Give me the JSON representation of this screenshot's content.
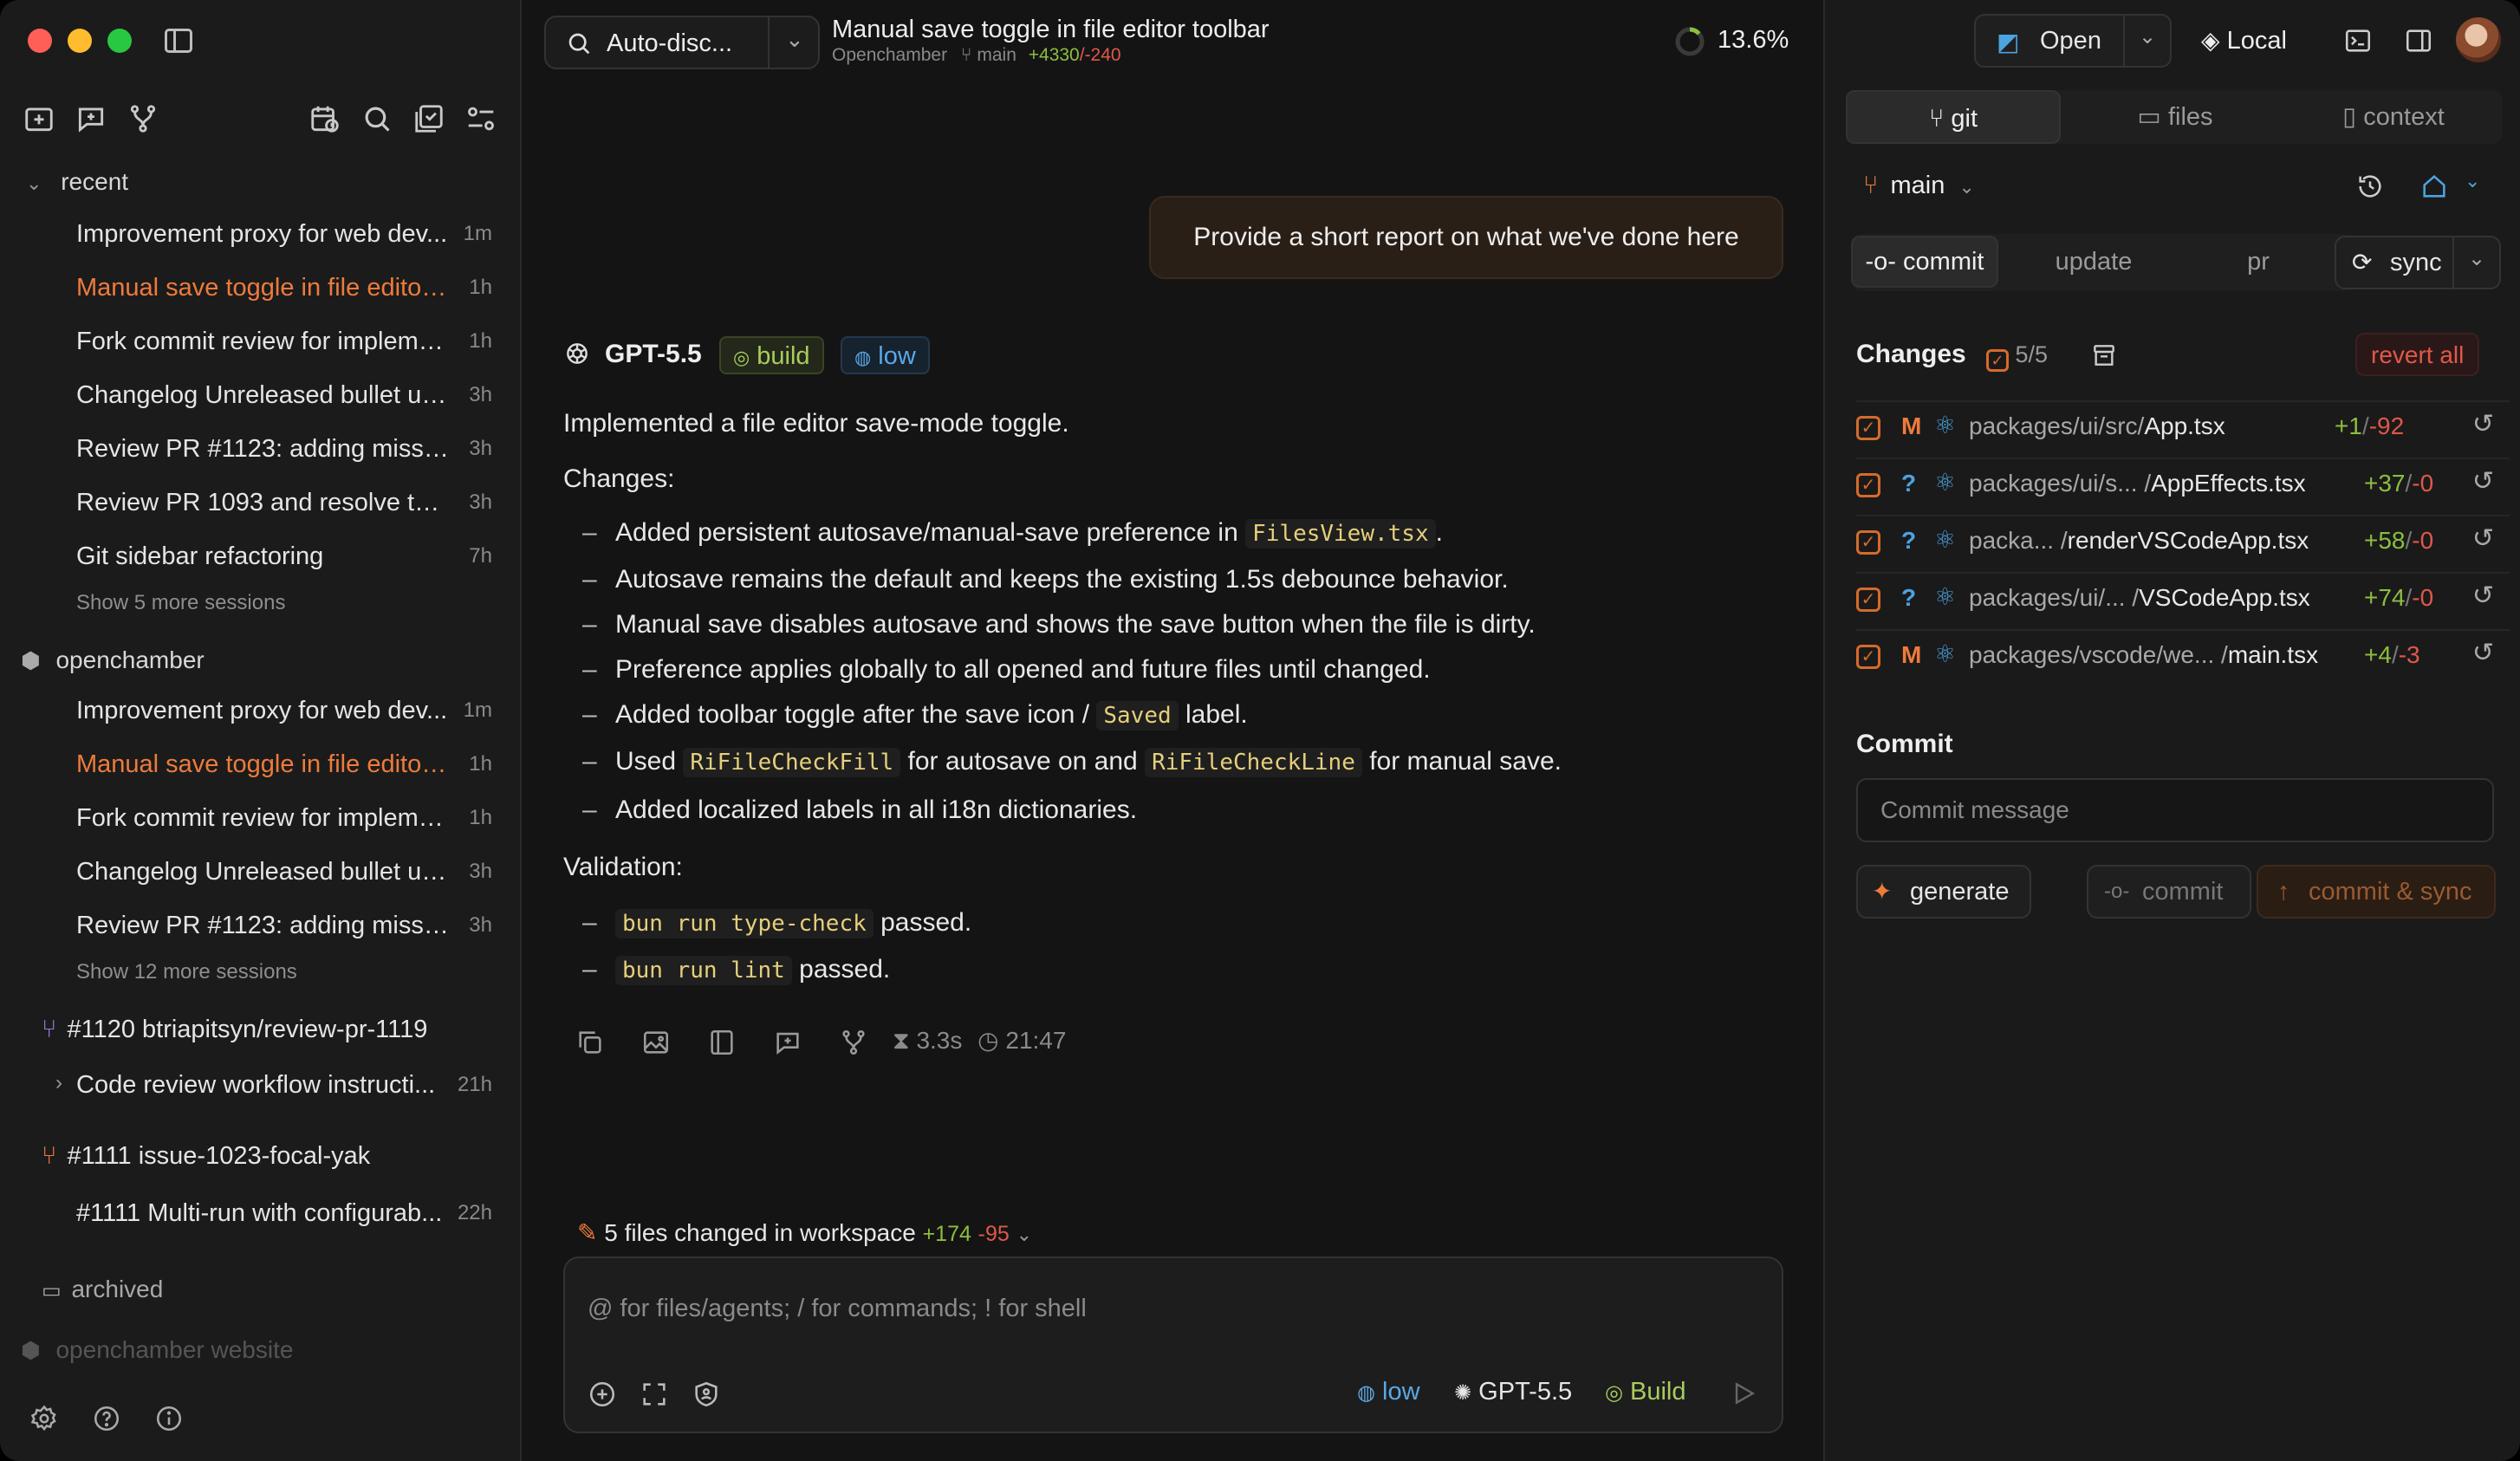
{
  "sidebar": {
    "recent_label": "recent",
    "recent": [
      {
        "title": "Improvement proxy for web dev...",
        "time": "1m"
      },
      {
        "title": "Manual save toggle in file editor...",
        "time": "1h"
      },
      {
        "title": "Fork commit review for impleme...",
        "time": "1h"
      },
      {
        "title": "Changelog Unreleased bullet up...",
        "time": "3h"
      },
      {
        "title": "Review PR #1123: adding missin...",
        "time": "3h"
      },
      {
        "title": "Review PR 1093 and resolve the...",
        "time": "3h"
      },
      {
        "title": "Git sidebar refactoring",
        "time": "7h"
      }
    ],
    "recent_more": "Show 5 more sessions",
    "project_label": "openchamber",
    "project": [
      {
        "title": "Improvement proxy for web dev...",
        "time": "1m"
      },
      {
        "title": "Manual save toggle in file editor...",
        "time": "1h"
      },
      {
        "title": "Fork commit review for impleme...",
        "time": "1h"
      },
      {
        "title": "Changelog Unreleased bullet up...",
        "time": "3h"
      },
      {
        "title": "Review PR #1123: adding missin...",
        "time": "3h"
      }
    ],
    "project_more": "Show 12 more sessions",
    "wt1_label": "#1120 btriapitsyn/review-pr-1119",
    "wt1_item": {
      "title": "Code review workflow instructi...",
      "time": "21h"
    },
    "wt2_label": "#1111 issue-1023-focal-yak",
    "wt2_item": {
      "title": "#1111 Multi-run with configurab...",
      "time": "22h"
    },
    "archived_label": "archived",
    "website_label": "openchamber website"
  },
  "header": {
    "agent_select": "Auto-disc...",
    "title": "Manual save toggle in file editor toolbar",
    "repo": "Openchamber",
    "branch": "main",
    "added": "+4330",
    "removed": "/-240",
    "progress": "13.6%"
  },
  "chat": {
    "user_message": "Provide a short report on what we've done here",
    "model": "GPT-5.5",
    "mode_tag": "build",
    "effort_tag": "low",
    "intro": "Implemented a file editor save-mode toggle.",
    "changes_heading": "Changes:",
    "b1_pre": "Added persistent autosave/manual-save preference in ",
    "b1_code": "FilesView.tsx",
    "b1_post": ".",
    "b2": "Autosave remains the default and keeps the existing 1.5s debounce behavior.",
    "b3": "Manual save disables autosave and shows the save button when the file is dirty.",
    "b4": "Preference applies globally to all opened and future files until changed.",
    "b5_pre": "Added toolbar toggle after the save icon / ",
    "b5_code": "Saved",
    "b5_post": " label.",
    "b6_pre": "Used ",
    "b6_code1": "RiFileCheckFill",
    "b6_mid": " for autosave on and ",
    "b6_code2": "RiFileCheckLine",
    "b6_post": " for manual save.",
    "b7": "Added localized labels in all i18n dictionaries.",
    "validation_heading": "Validation:",
    "v1_code": "bun run type-check",
    "v1_post": " passed.",
    "v2_code": "bun run lint",
    "v2_post": " passed.",
    "duration": "3.3s",
    "clock": "21:47",
    "files_changed": "5 files changed in workspace",
    "files_added": "+174",
    "files_removed": "-95"
  },
  "composer": {
    "placeholder": "@ for files/agents; / for commands; ! for shell",
    "effort": "low",
    "model": "GPT-5.5",
    "mode": "Build"
  },
  "topright": {
    "open_label": "Open",
    "local_label": "Local"
  },
  "git": {
    "tabs": [
      "git",
      "files",
      "context"
    ],
    "branch": "main",
    "subtabs": [
      "commit",
      "update",
      "pr"
    ],
    "sync_label": "sync",
    "changes_label": "Changes",
    "changes_count": "5/5",
    "revert_all": "revert all",
    "files": [
      {
        "status": "M",
        "dir": "packages/ui/src/",
        "name": "App.tsx",
        "add": "+1",
        "del": "-92"
      },
      {
        "status": "?",
        "dir": "packages/ui/s... /",
        "name": "AppEffects.tsx",
        "add": "+37",
        "del": "-0"
      },
      {
        "status": "?",
        "dir": "packa... /",
        "name": "renderVSCodeApp.tsx",
        "add": "+58",
        "del": "-0"
      },
      {
        "status": "?",
        "dir": "packages/ui/... /",
        "name": "VSCodeApp.tsx",
        "add": "+74",
        "del": "-0"
      },
      {
        "status": "M",
        "dir": "packages/vscode/we... /",
        "name": "main.tsx",
        "add": "+4",
        "del": "-3"
      }
    ],
    "commit_heading": "Commit",
    "commit_placeholder": "Commit message",
    "generate_label": "generate",
    "commit_label": "commit",
    "commit_sync_label": "commit & sync"
  },
  "colors": {
    "accent": "#ee7b3c",
    "added": "#8bbf3f",
    "removed": "#e0584a",
    "info": "#4ba3e0"
  }
}
